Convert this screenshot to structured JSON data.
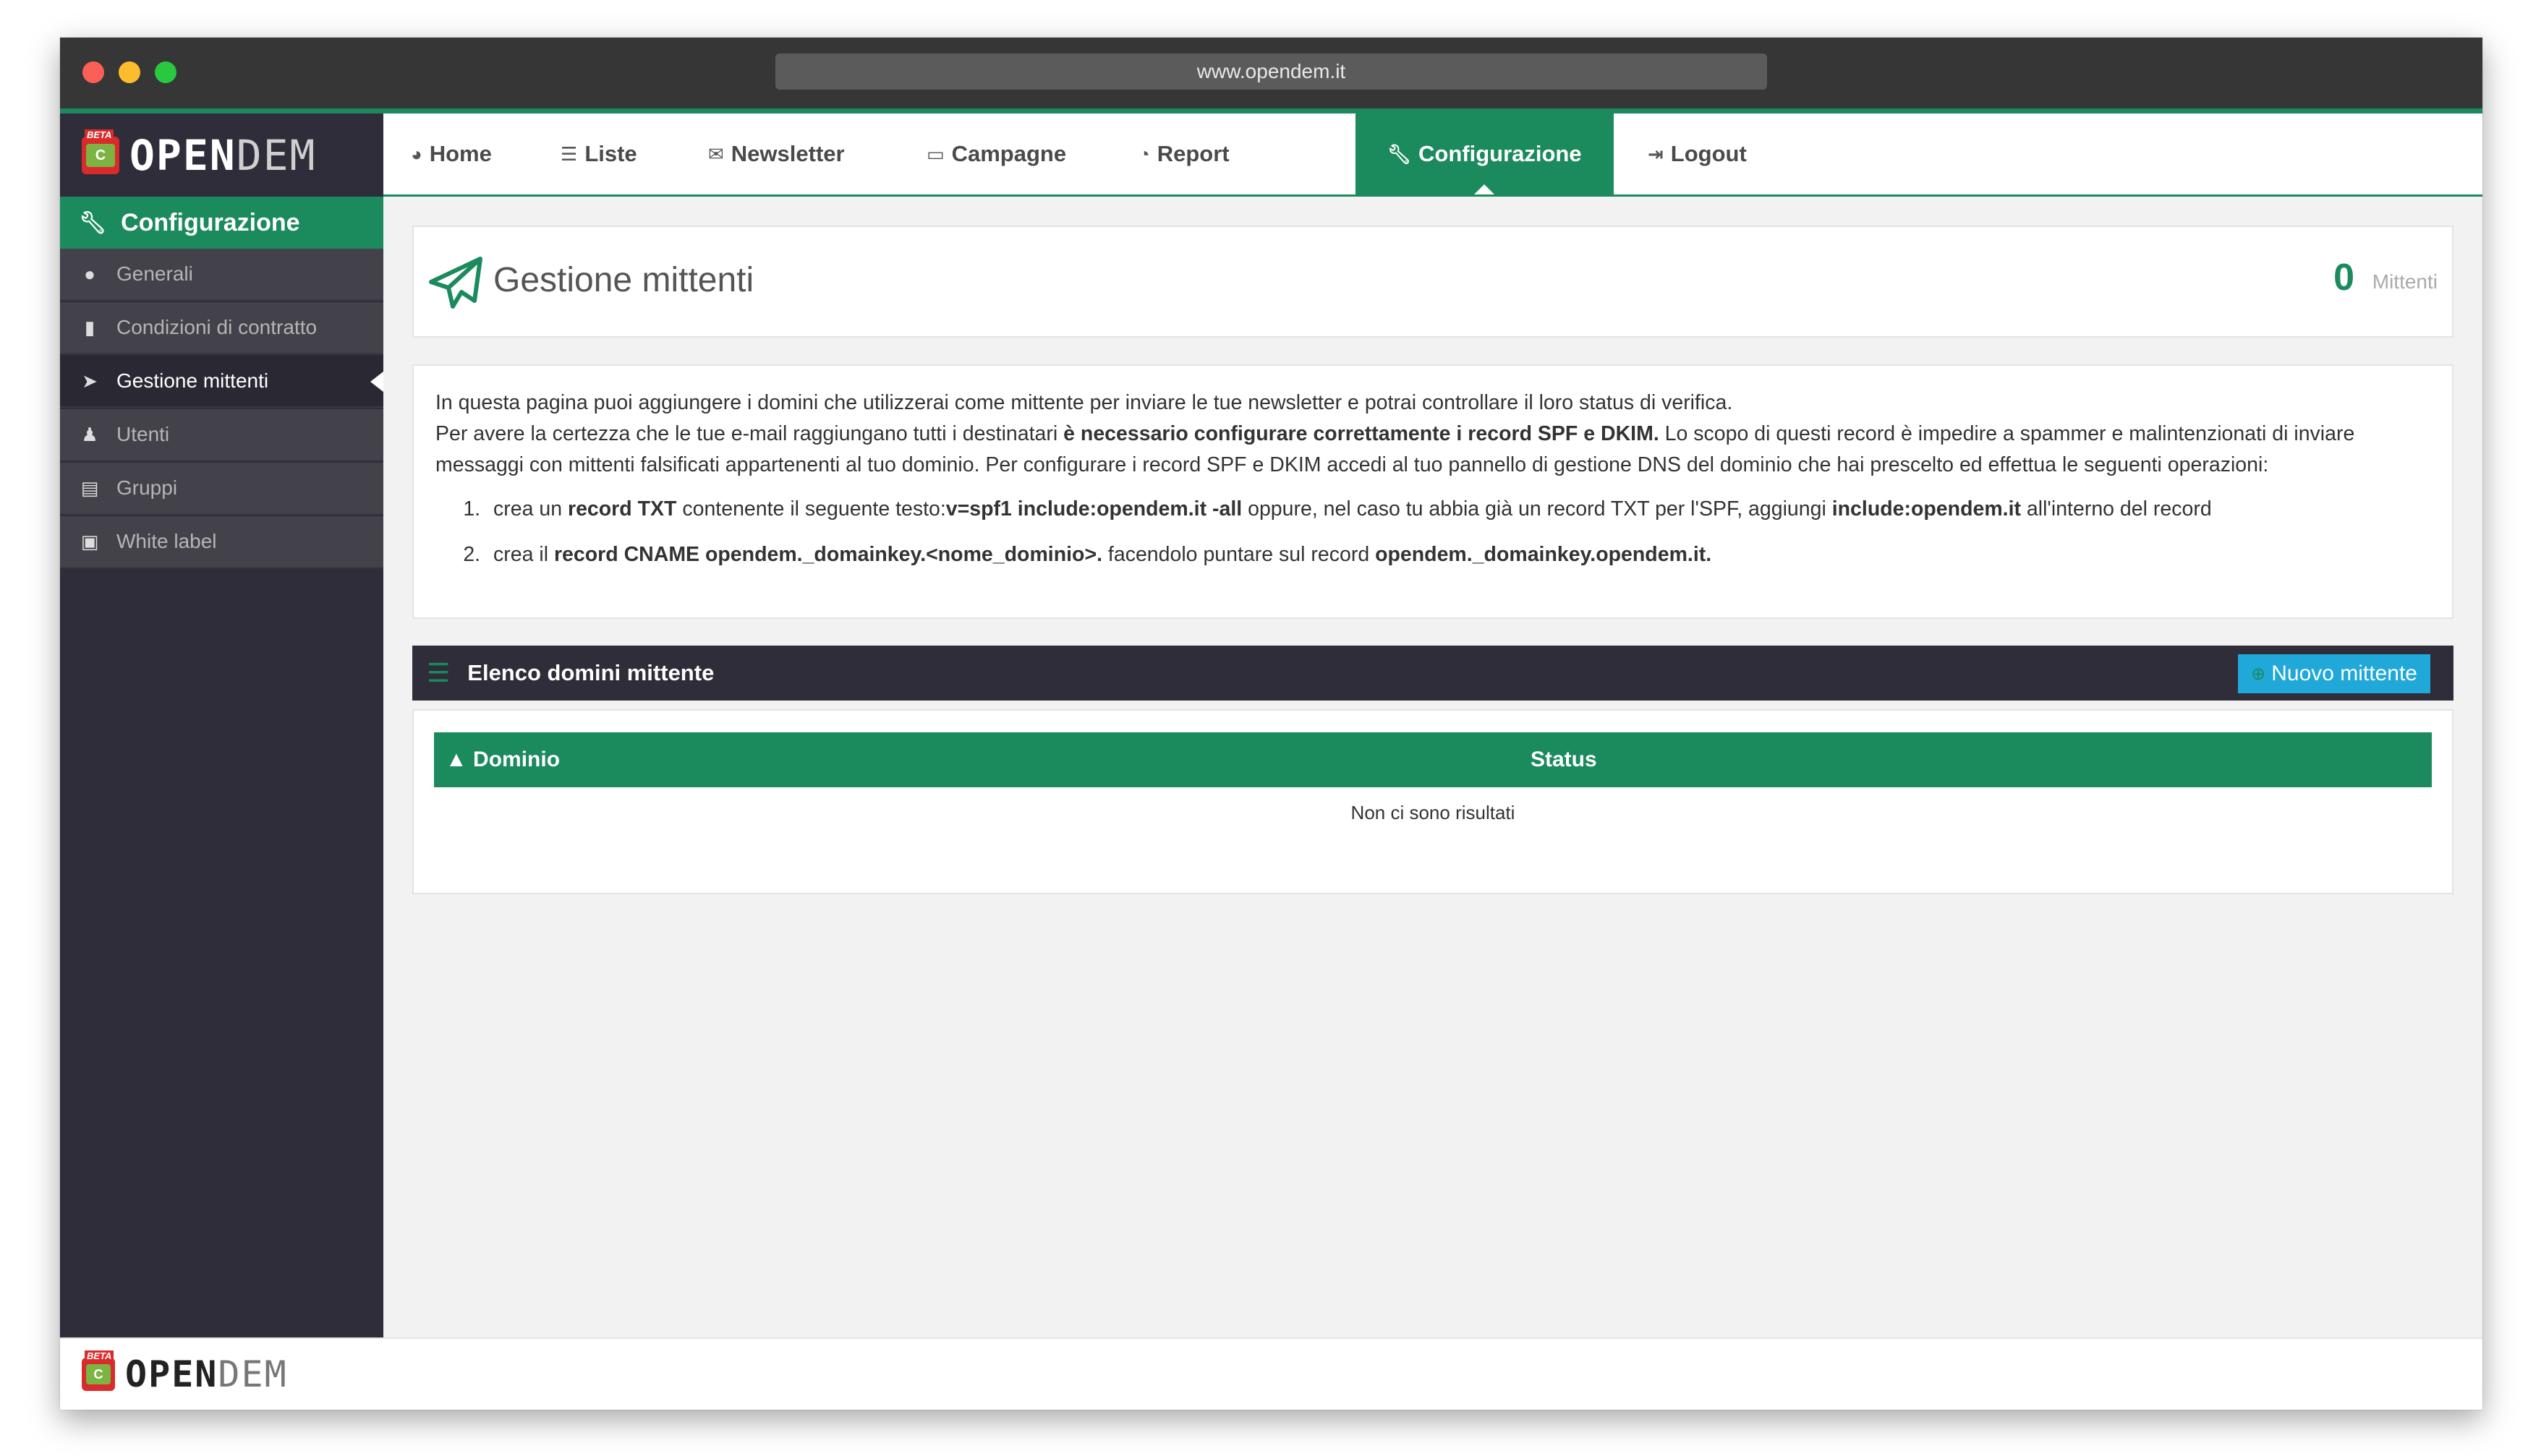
{
  "browser": {
    "url": "www.opendem.it"
  },
  "brand": {
    "logo_open": "OPEN",
    "logo_dem": "DEM",
    "badge": "BETA",
    "badge_mark": "C"
  },
  "topnav": {
    "items": [
      {
        "label": "Home",
        "icon": "dashboard-icon"
      },
      {
        "label": "Liste",
        "icon": "list-icon"
      },
      {
        "label": "Newsletter",
        "icon": "envelope-icon"
      },
      {
        "label": "Campagne",
        "icon": "folder-icon"
      },
      {
        "label": "Report",
        "icon": "pie-chart-icon"
      },
      {
        "label": "Configurazione",
        "icon": "wrench-icon",
        "active": true
      },
      {
        "label": "Logout",
        "icon": "sign-out-icon"
      }
    ]
  },
  "sidebar": {
    "section": "Configurazione",
    "items": [
      {
        "label": "Generali",
        "icon": "globe-icon"
      },
      {
        "label": "Condizioni di contratto",
        "icon": "file-icon"
      },
      {
        "label": "Gestione mittenti",
        "icon": "paper-plane-icon",
        "active": true
      },
      {
        "label": "Utenti",
        "icon": "users-icon"
      },
      {
        "label": "Gruppi",
        "icon": "id-card-icon"
      },
      {
        "label": "White label",
        "icon": "image-icon"
      }
    ]
  },
  "page": {
    "title": "Gestione mittenti",
    "count": "0",
    "count_label": "Mittenti"
  },
  "info": {
    "line1": "In questa pagina puoi aggiungere i domini che utilizzerai come mittente per inviare le tue newsletter e potrai controllare il loro status di verifica.",
    "line2_a": "Per avere la certezza che le tue e-mail raggiungano tutti i destinatari ",
    "line2_b": "è necessario configurare correttamente i record SPF e DKIM.",
    "line2_c": " Lo scopo di questi record è impedire a spammer e malintenzionati di inviare messaggi con mittenti falsificati appartenenti al tuo dominio. Per configurare i record SPF e DKIM accedi al tuo pannello di gestione DNS del dominio che hai prescelto ed effettua le seguenti operazioni:",
    "step1_a": "crea un ",
    "step1_b": "record TXT",
    "step1_c": " contenente il seguente testo:",
    "step1_d": "v=spf1 include:opendem.it -all",
    "step1_e": " oppure, nel caso tu abbia già un record TXT per l'SPF, aggiungi ",
    "step1_f": "include:opendem.it",
    "step1_g": " all'interno del record",
    "step2_a": "crea il ",
    "step2_b": "record CNAME opendem._domainkey.<nome_dominio>.",
    "step2_c": " facendolo puntare sul record ",
    "step2_d": "opendem._domainkey.opendem.it."
  },
  "list": {
    "title": "Elenco domini mittente",
    "new_button": "Nuovo mittente",
    "columns": [
      "▲ Dominio",
      "Status"
    ],
    "rows": [],
    "empty_text": "Non ci sono risultati"
  },
  "colors": {
    "accent": "#1b8a5d",
    "dark": "#2e2d39",
    "button": "#1fa8d8"
  }
}
